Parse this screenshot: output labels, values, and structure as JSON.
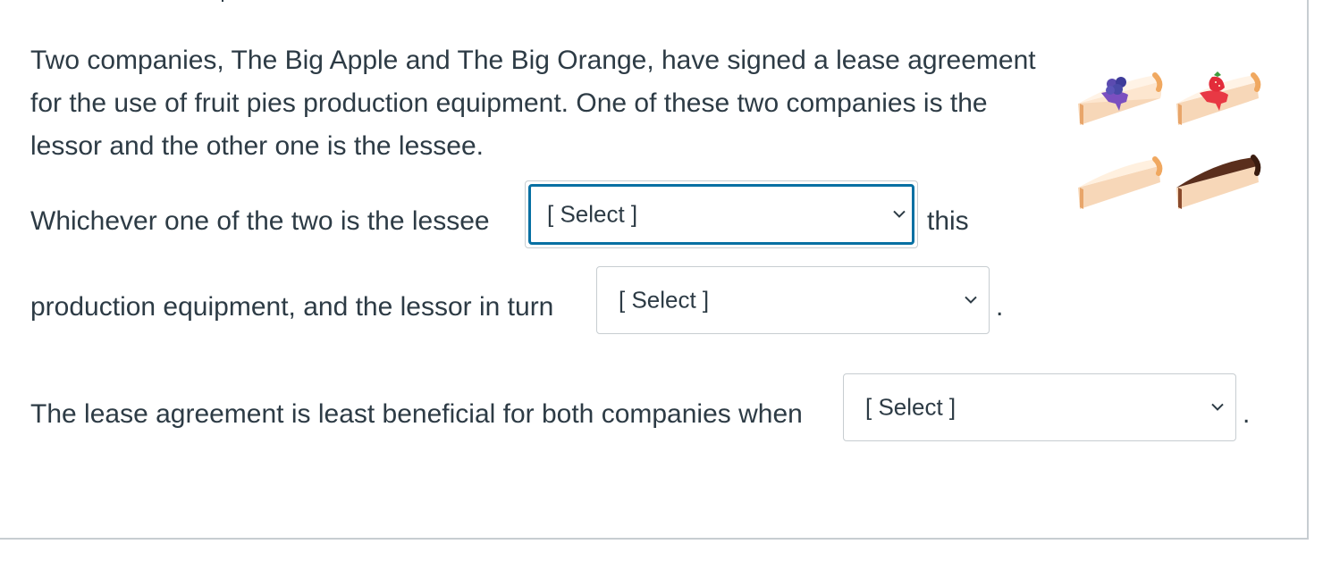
{
  "question": {
    "intro_lines": [
      "Two companies, The Big Apple and The Big Orange, have signed a lease agreement",
      "for the use of fruit pies production equipment. One of these two companies is the",
      "lessor and the other one is the lessee."
    ],
    "sentence1_prefix": "Whichever one of the two is the lessee",
    "sentence1_suffix": "this",
    "sentence2_prefix": "production equipment, and the lessor in turn",
    "sentence2_suffix": ".",
    "sentence3_prefix": "The lease agreement is least beneficial for both companies when",
    "sentence3_suffix": "."
  },
  "dropdowns": [
    {
      "selected": "[ Select ]"
    },
    {
      "selected": "[ Select ]"
    },
    {
      "selected": "[ Select ]"
    }
  ],
  "icons": {
    "chevron": "chevron-down-icon",
    "pies": [
      "blueberry-pie-slice",
      "strawberry-pie-slice",
      "plain-cheesecake-slice",
      "chocolate-pie-slice"
    ]
  },
  "colors": {
    "text": "#2d3b45",
    "focus_ring": "#0770a3",
    "border": "#c7cdd1"
  }
}
